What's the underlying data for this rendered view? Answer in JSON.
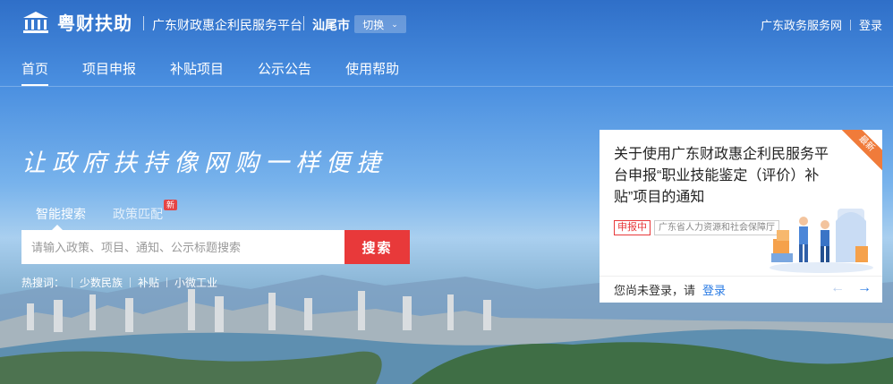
{
  "header": {
    "brand": "粤财扶助",
    "platform": "广东财政惠企利民服务平台",
    "city": "汕尾市",
    "switch_label": "切换",
    "links": [
      "广东政务服务网",
      "登录"
    ]
  },
  "nav": {
    "items": [
      "首页",
      "项目申报",
      "补贴项目",
      "公示公告",
      "使用帮助"
    ]
  },
  "hero": {
    "slogan": "让政府扶持像网购一样便捷"
  },
  "search": {
    "tabs": [
      {
        "label": "智能搜索"
      },
      {
        "label": "政策匹配",
        "badge": "新"
      }
    ],
    "placeholder": "请输入政策、项目、通知、公示标题搜索",
    "button": "搜索"
  },
  "hot": {
    "label": "热搜词：",
    "keywords": [
      "少数民族",
      "补贴",
      "小微工业"
    ]
  },
  "notice": {
    "ribbon": "最新",
    "title": "关于使用广东财政惠企利民服务平台申报“职业技能鉴定（评价）补贴”项目的通知",
    "status": "申报中",
    "department": "广东省人力资源和社会保障厅",
    "login_prompt": "您尚未登录，请",
    "login_link": "登录"
  },
  "colors": {
    "accent": "#e8393a",
    "link": "#2a7be4",
    "ribbon": "#f07b3a"
  }
}
